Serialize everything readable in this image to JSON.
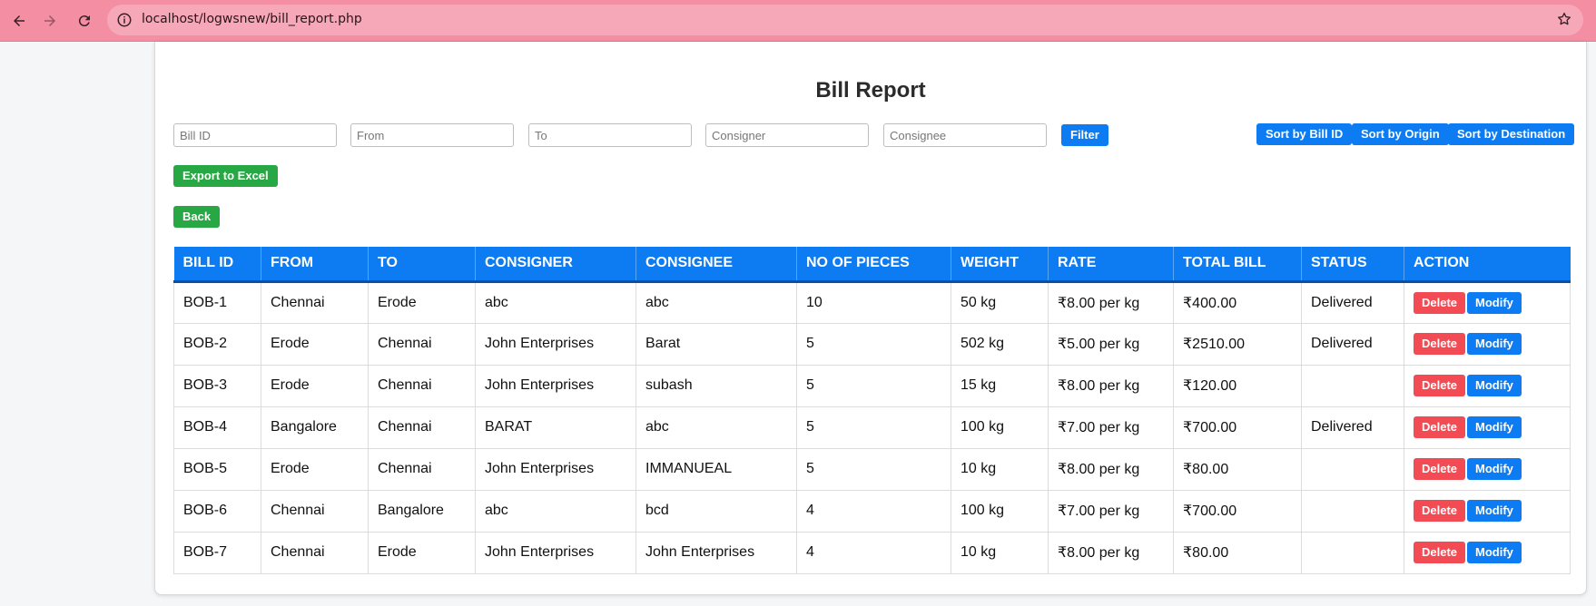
{
  "browser": {
    "url": "localhost/logwsnew/bill_report.php"
  },
  "page": {
    "title": "Bill Report"
  },
  "filters": {
    "bill_id_placeholder": "Bill ID",
    "from_placeholder": "From",
    "to_placeholder": "To",
    "consigner_placeholder": "Consigner",
    "consignee_placeholder": "Consignee",
    "filter_label": "Filter"
  },
  "sort": {
    "by_bill_id": "Sort by Bill ID",
    "by_origin": "Sort by Origin",
    "by_destination": "Sort by Destination"
  },
  "actions": {
    "export_label": "Export to Excel",
    "back_label": "Back"
  },
  "table": {
    "headers": [
      "BILL ID",
      "FROM",
      "TO",
      "CONSIGNER",
      "CONSIGNEE",
      "NO OF PIECES",
      "WEIGHT",
      "RATE",
      "TOTAL BILL",
      "STATUS",
      "ACTION"
    ],
    "delete_label": "Delete",
    "modify_label": "Modify",
    "rows": [
      [
        "BOB-1",
        "Chennai",
        "Erode",
        "abc",
        "abc",
        "10",
        "50 kg",
        "₹8.00 per kg",
        "₹400.00",
        "Delivered"
      ],
      [
        "BOB-2",
        "Erode",
        "Chennai",
        "John Enterprises",
        "Barat",
        "5",
        "502 kg",
        "₹5.00 per kg",
        "₹2510.00",
        "Delivered"
      ],
      [
        "BOB-3",
        "Erode",
        "Chennai",
        "John Enterprises",
        "subash",
        "5",
        "15 kg",
        "₹8.00 per kg",
        "₹120.00",
        ""
      ],
      [
        "BOB-4",
        "Bangalore",
        "Chennai",
        "BARAT",
        "abc",
        "5",
        "100 kg",
        "₹7.00 per kg",
        "₹700.00",
        "Delivered"
      ],
      [
        "BOB-5",
        "Erode",
        "Chennai",
        "John Enterprises",
        "IMMANUEAL",
        "5",
        "10 kg",
        "₹8.00 per kg",
        "₹80.00",
        ""
      ],
      [
        "BOB-6",
        "Chennai",
        "Bangalore",
        "abc",
        "bcd",
        "4",
        "100 kg",
        "₹7.00 per kg",
        "₹700.00",
        ""
      ],
      [
        "BOB-7",
        "Chennai",
        "Erode",
        "John Enterprises",
        "John Enterprises",
        "4",
        "10 kg",
        "₹8.00 per kg",
        "₹80.00",
        ""
      ]
    ]
  },
  "colors": {
    "primary": "#0d7bf2",
    "success": "#28a745",
    "danger": "#f24b53",
    "browser_bar": "#f48ea3"
  }
}
